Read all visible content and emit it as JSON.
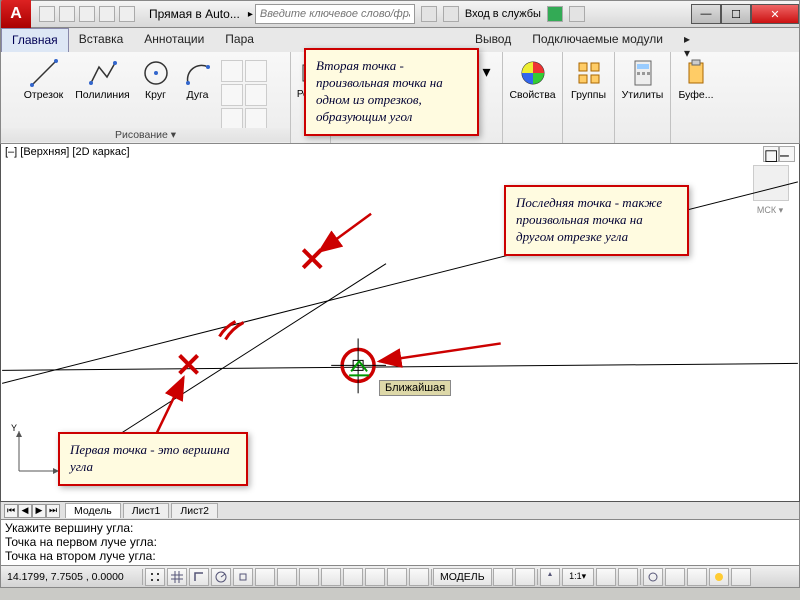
{
  "titlebar": {
    "title": "Прямая в Auto...",
    "search_placeholder": "Введите ключевое слово/фразу",
    "login_label": "Вход в службы"
  },
  "tabs": {
    "home": "Главная",
    "insert": "Вставка",
    "annotate": "Аннотации",
    "param": "Пара",
    "output": "Вывод",
    "plugins": "Подключаемые модули"
  },
  "ribbon": {
    "draw": {
      "title": "Рисование ▾",
      "line": "Отрезок",
      "polyline": "Полилиния",
      "circle": "Круг",
      "arc": "Дуга"
    },
    "edit": {
      "label": "Редак"
    },
    "props": {
      "label": "Свойства"
    },
    "groups": {
      "label": "Группы"
    },
    "utils": {
      "label": "Утилиты"
    },
    "buffer": {
      "label": "Буфе..."
    }
  },
  "viewport": {
    "label": "[–] [Верхняя] [2D каркас]",
    "snap_tip": "Ближайшая",
    "wcs": "МСК ▾"
  },
  "callouts": {
    "c1": "Вторая точка - произвольная точка на одном из отрезков, образующим угол",
    "c2": "Последняя точка - также произвольная точка на другом отрезке угла",
    "c3": "Первая точка - это вершина угла"
  },
  "modeltabs": {
    "model": "Модель",
    "sheet1": "Лист1",
    "sheet2": "Лист2"
  },
  "cmdline": {
    "l1": "Укажите вершину угла:",
    "l2": "Точка на первом луче угла:",
    "l3": "Точка на втором луче угла:"
  },
  "statusbar": {
    "coords": "14.1799, 7.7505 , 0.0000",
    "model": "МОДЕЛЬ"
  }
}
